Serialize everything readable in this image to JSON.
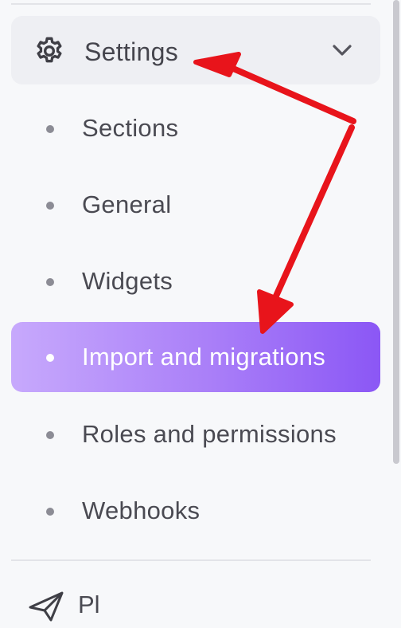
{
  "settings": {
    "label": "Settings",
    "icon": "gear-icon",
    "expand_icon": "chevron-down-icon",
    "expanded": true
  },
  "menu": {
    "items": [
      {
        "label": "Sections",
        "active": false
      },
      {
        "label": "General",
        "active": false
      },
      {
        "label": "Widgets",
        "active": false
      },
      {
        "label": "Import and migrations",
        "active": true
      },
      {
        "label": "Roles and permissions",
        "active": false
      },
      {
        "label": "Webhooks",
        "active": false
      }
    ]
  },
  "next_section": {
    "label": "Pl",
    "icon": "paper-plane-icon"
  },
  "colors": {
    "active_gradient_start": "#c7a9fc",
    "active_gradient_end": "#8b57f5",
    "annotation_arrow": "#e8141b"
  }
}
